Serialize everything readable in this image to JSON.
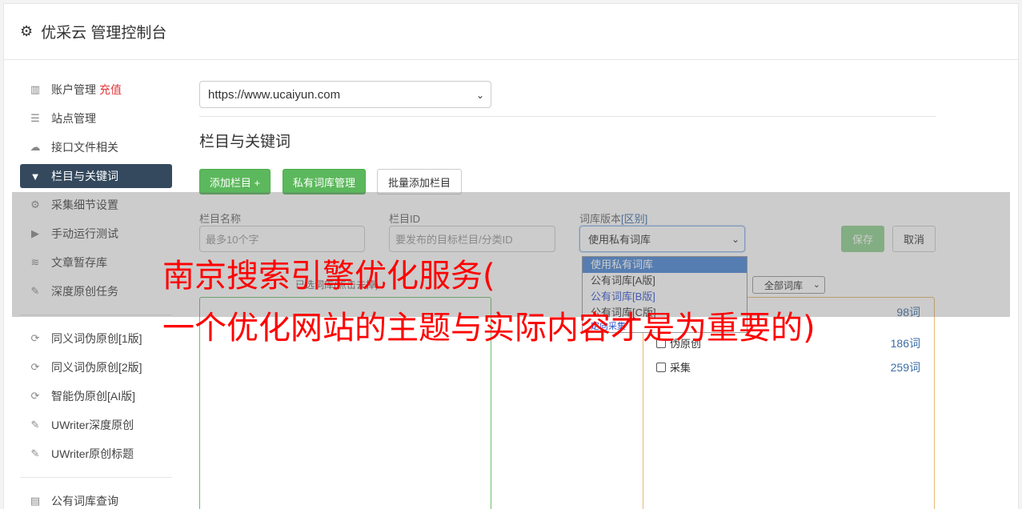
{
  "header": {
    "title": "优采云 管理控制台",
    "icon": "gear-icon"
  },
  "sidebar": {
    "items": [
      {
        "label": "账户管理",
        "extra": "充值",
        "icon": "bar-chart-icon"
      },
      {
        "label": "站点管理",
        "icon": "server-icon"
      },
      {
        "label": "接口文件相关",
        "icon": "cloud-upload-icon"
      },
      {
        "label": "栏目与关键词",
        "icon": "filter-icon",
        "active": true
      },
      {
        "label": "采集细节设置",
        "icon": "cogs-icon"
      },
      {
        "label": "手动运行测试",
        "icon": "play-circle-icon"
      },
      {
        "label": "文章暂存库",
        "icon": "database-icon"
      },
      {
        "label": "深度原创任务",
        "icon": "edit-icon"
      },
      {
        "label": "同义词伪原创[1版]",
        "icon": "refresh-icon"
      },
      {
        "label": "同义词伪原创[2版]",
        "icon": "refresh-icon"
      },
      {
        "label": "智能伪原创[AI版]",
        "icon": "refresh-icon"
      },
      {
        "label": "UWriter深度原创",
        "icon": "edit-icon"
      },
      {
        "label": "UWriter原创标题",
        "icon": "edit-icon"
      },
      {
        "label": "公有词库查询",
        "icon": "book-icon"
      }
    ]
  },
  "main": {
    "site_select": "https://www.ucaiyun.com",
    "section_title": "栏目与关键词",
    "buttons": {
      "add_column": "添加栏目 +",
      "private_lib": "私有词库管理",
      "batch_add": "批量添加栏目"
    },
    "form": {
      "col_name_label": "栏目名称",
      "col_name_placeholder": "最多10个字",
      "col_id_label": "栏目ID",
      "col_id_placeholder": "要发布的目标栏目/分类ID",
      "lib_version_label": "词库版本",
      "lib_version_link": "[区别]",
      "lib_version_value": "使用私有词库",
      "save": "保存",
      "cancel": "取消"
    },
    "dropdown_options": [
      {
        "label": "使用私有词库",
        "selected": true
      },
      {
        "label": "公有词库[A版]"
      },
      {
        "label": "公有词库[B版]",
        "blue": true
      },
      {
        "label": "公有词库[C版]"
      }
    ],
    "hint_text": "已选词库(点击去掉)",
    "lib_filter": "全部词库",
    "libraries": [
      {
        "name": "",
        "count": "98词"
      },
      {
        "name": "伪原创",
        "count": "186词"
      },
      {
        "name": "采集",
        "count": "259词"
      }
    ],
    "partial_link": "定向采集"
  },
  "overlay": {
    "line1": "南京搜索引擎优化服务(",
    "line2": "一个优化网站的主题与实际内容才是为重要的)"
  }
}
